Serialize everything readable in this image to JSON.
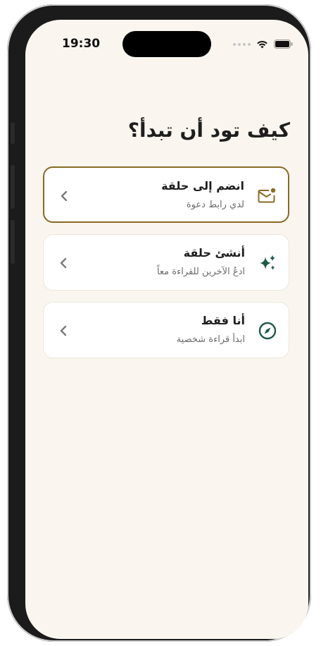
{
  "status_bar": {
    "time": "19:30"
  },
  "page": {
    "title": "كيف تود أن تبدأ؟"
  },
  "options": [
    {
      "label": "انضم إلى حلقة",
      "subtitle": "لدي رابط دعوة",
      "icon": "envelope-icon",
      "selected": true
    },
    {
      "label": "أنشئ حلقة",
      "subtitle": "ادعُ الآخرين للقراءة معاً",
      "icon": "sparkles-icon",
      "selected": false
    },
    {
      "label": "أنا فقط",
      "subtitle": "ابدأ قراءة شخصية",
      "icon": "compass-icon",
      "selected": false
    }
  ],
  "colors": {
    "background": "#faf6ef",
    "accent_gold": "#8a6a25",
    "accent_green": "#1e5a45"
  }
}
